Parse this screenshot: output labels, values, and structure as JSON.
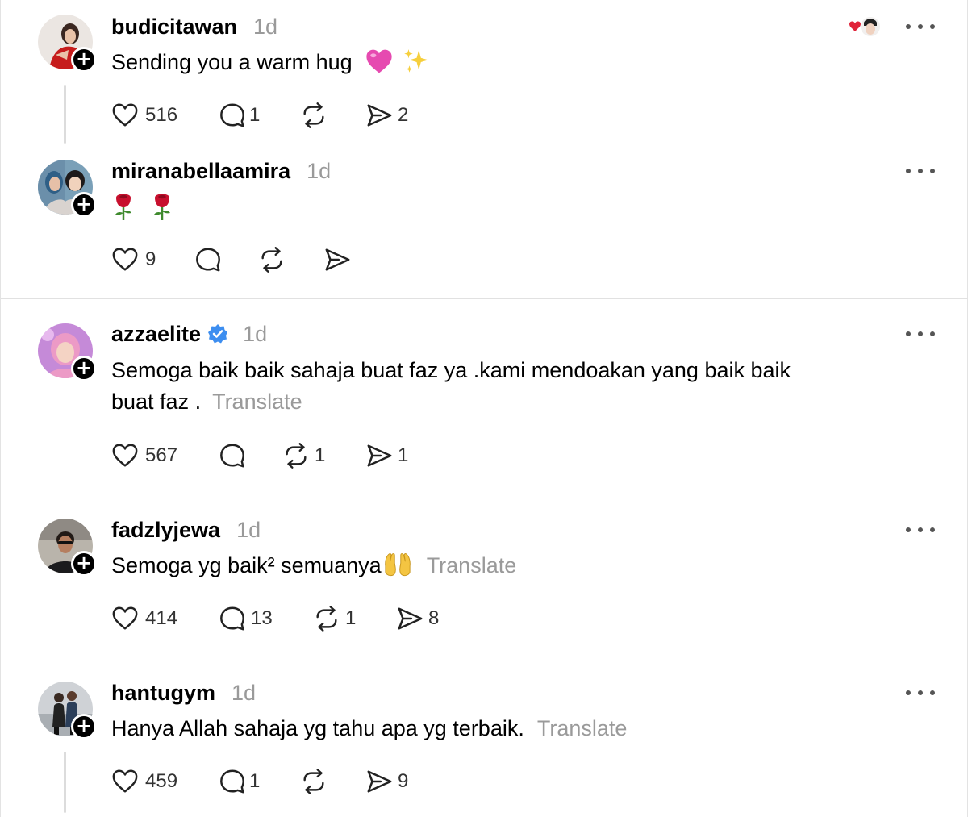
{
  "posts": [
    {
      "username": "budicitawan",
      "time": "1d",
      "text": "Sending you a warm hug",
      "likes": "516",
      "comments": "1",
      "reposts": "",
      "shares": "2"
    },
    {
      "username": "miranabellaamira",
      "time": "1d",
      "text": "",
      "likes": "9",
      "comments": "",
      "reposts": "",
      "shares": ""
    },
    {
      "username": "azzaelite",
      "time": "1d",
      "text_line1": "Semoga baik baik sahaja buat faz ya .kami mendoakan yang baik baik",
      "text_line2": "buat faz .",
      "translate": "Translate",
      "likes": "567",
      "comments": "",
      "reposts": "1",
      "shares": "1"
    },
    {
      "username": "fadzlyjewa",
      "time": "1d",
      "text": "Semoga yg baik² semuanya",
      "translate": "Translate",
      "likes": "414",
      "comments": "13",
      "reposts": "1",
      "shares": "8"
    },
    {
      "username": "hantugym",
      "time": "1d",
      "text": "Hanya Allah sahaja yg tahu apa yg terbaik.",
      "translate": "Translate",
      "likes": "459",
      "comments": "1",
      "reposts": "",
      "shares": "9"
    }
  ],
  "icons": {
    "like": "heart-outline-icon",
    "comment": "speech-bubble-icon",
    "repost": "repost-arrows-icon",
    "share": "paper-plane-icon",
    "more": "more-dots-icon",
    "follow": "plus-icon",
    "verified": "verified-badge-icon"
  },
  "colors": {
    "verified": "#3d8ef0",
    "muted_text": "#9a9a9a",
    "divider": "#e1e1e1"
  }
}
